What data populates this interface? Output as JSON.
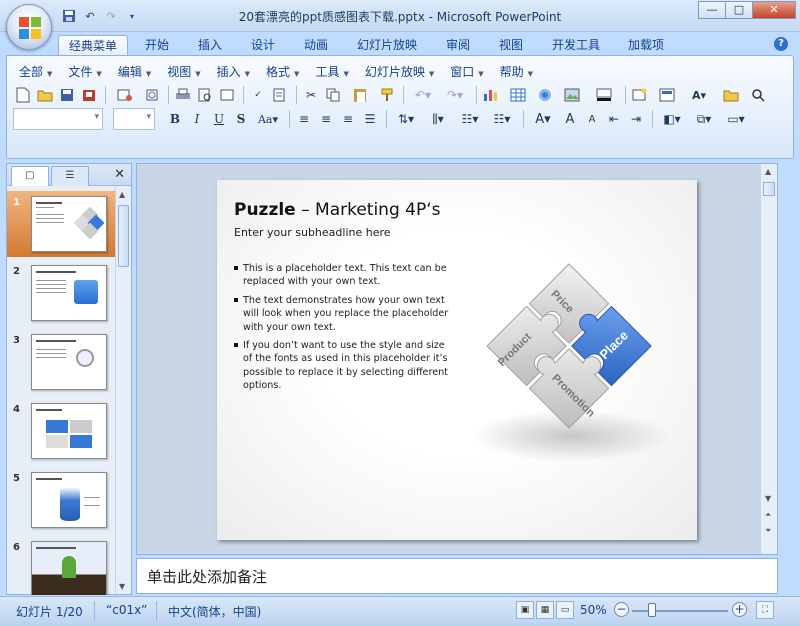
{
  "window": {
    "title": "20套漂亮的ppt质感图表下载.pptx - Microsoft PowerPoint",
    "minimize": "—",
    "maximize": "□",
    "close": "✕"
  },
  "quick_access": [
    "save-icon",
    "undo-icon",
    "redo-icon",
    "customize-icon"
  ],
  "tabs": [
    {
      "label": "经典菜单",
      "active": true
    },
    {
      "label": "开始"
    },
    {
      "label": "插入"
    },
    {
      "label": "设计"
    },
    {
      "label": "动画"
    },
    {
      "label": "幻灯片放映"
    },
    {
      "label": "审阅"
    },
    {
      "label": "视图"
    },
    {
      "label": "开发工具"
    },
    {
      "label": "加载项"
    }
  ],
  "help": "?",
  "menu": [
    "全部",
    "文件",
    "编辑",
    "视图",
    "插入",
    "格式",
    "工具",
    "幻灯片放映",
    "窗口",
    "帮助"
  ],
  "left_panel": {
    "tab1": "▢",
    "tab2": "☰",
    "close": "✕",
    "thumbnails": [
      {
        "num": "1",
        "selected": true
      },
      {
        "num": "2"
      },
      {
        "num": "3"
      },
      {
        "num": "4"
      },
      {
        "num": "5"
      },
      {
        "num": "6"
      }
    ]
  },
  "slide": {
    "title_bold": "Puzzle",
    "title_rest": " – Marketing 4P‘s",
    "subtitle": "Enter your subheadline here",
    "bullets": [
      "This is a placeholder text. This text can be replaced with your own text.",
      "The text demonstrates how your own text will look when you replace the placeholder with your own text.",
      "If you don’t want to use the style and size of the fonts as used in this placeholder it’s possible to replace it by selecting different options."
    ],
    "puzzle": {
      "price": "Price",
      "product": "Product",
      "place": "Place",
      "promotion": "Promotion",
      "accent": "#3a78d6",
      "piece_color": "#d6d6d6"
    }
  },
  "notes": {
    "placeholder": "单击此处添加备注"
  },
  "status": {
    "slide": "幻灯片 1/20",
    "theme": "“c01x”",
    "language": "中文(简体，中国)",
    "zoom": "50%",
    "zoom_level": 0.5,
    "zoom_minus": "−",
    "zoom_plus": "+"
  }
}
